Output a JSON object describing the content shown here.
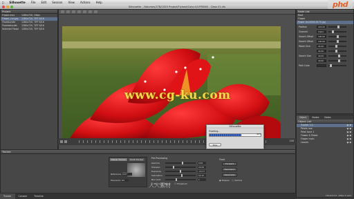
{
  "menubar": {
    "apple": "",
    "app_name": "Silhouette",
    "items": [
      "File",
      "Edit",
      "Session",
      "View",
      "Actions",
      "Help"
    ]
  },
  "window": {
    "title": "Silhouette - /Volumes/1TB/CS55 Project/Flyland/Color-0/LFP0060 - Class 01.sfx"
  },
  "logo": "phd",
  "project": {
    "title": "Project",
    "items": [
      {
        "name": "Flower.mov",
        "info": "1280x720, 24fps"
      },
      {
        "name": "Flower_run.jpg",
        "info": "1280x720, TIFF 8/16"
      },
      {
        "name": "Trackbundle",
        "info": "1280x720, TIFF 8/16"
      },
      {
        "name": "Trackdata.dat",
        "info": "1280x720, TIFF 8/16"
      },
      {
        "name": "Selected Flowers",
        "info": "1280x720, TIFF 8/16"
      }
    ]
  },
  "watermark": "www.cg-ku.com",
  "timeline": {
    "frame": "100"
  },
  "dialog": {
    "title": "Silhouette",
    "label": "Tracking...",
    "progress": 0.62,
    "percent": "62%",
    "button": "Stop"
  },
  "nodes": {
    "title": "Node List",
    "items": [
      "Root",
      "Flower",
      "Power rev.0000-0170.jpg"
    ]
  },
  "properties": {
    "rows": [
      {
        "label": "Position",
        "value": "224.00",
        "pos": 0.55
      },
      {
        "label": "Channel",
        "value": "Alpha",
        "pos": 0.2
      },
      {
        "label": "Search Offset",
        "value": "100.00",
        "pos": 0.5
      },
      {
        "label": "Search Offset",
        "value": "100.00",
        "pos": 0.5
      },
      {
        "label": "Match Size",
        "value": "24.00",
        "pos": 0.45
      },
      {
        "label": "",
        "value": "24.00",
        "pos": 0.45
      },
      {
        "label": "Search Size",
        "value": "40.00",
        "pos": 0.6
      },
      {
        "label": "",
        "value": "40.00",
        "pos": 0.6
      },
      {
        "label": "Path Color",
        "value": "",
        "pos": 0.1
      }
    ]
  },
  "objects": {
    "tabs": [
      "Object",
      "Nodes",
      "Notes"
    ],
    "list_title": "Object List",
    "items": [
      "Tracker 1.0",
      "Petals rear",
      "Petal back 1",
      "Flower & Petals",
      "Flower main",
      "Leaves"
    ]
  },
  "tracker": {
    "title": "Tracker",
    "tabs": [
      "Planar Tracker",
      "Point Tracker"
    ],
    "fields": [
      {
        "label": "Reference",
        "value": "Current Frame"
      },
      {
        "label": "Tolerance",
        "value": "95"
      }
    ]
  },
  "preprocessing": {
    "title": "Pre-Processing",
    "rows": [
      {
        "label": "Gamma",
        "value": "0.84",
        "pos": 0.58
      },
      {
        "label": "Sharpen",
        "value": "20.00",
        "pos": 0.25
      },
      {
        "label": "Exposure",
        "value": "-19.77",
        "pos": 0.5
      },
      {
        "label": "Saturation",
        "value": "52.22",
        "pos": 0.55
      },
      {
        "label": "Blur Amt",
        "value": "1",
        "pos": 0.35
      }
    ],
    "checks": [
      "Mix Color Blend",
      "Threshold"
    ]
  },
  "controls": {
    "title": "Track",
    "buttons": [
      "Forward",
      "Backward",
      "Resample"
    ],
    "radios": [
      "Shapes",
      "Vectors"
    ]
  },
  "bottom_tabs": [
    "Tracker",
    "Console",
    "Timeline"
  ],
  "status": "1512/1717, 10fps 4 secs",
  "cn_watermark": "人人素材"
}
